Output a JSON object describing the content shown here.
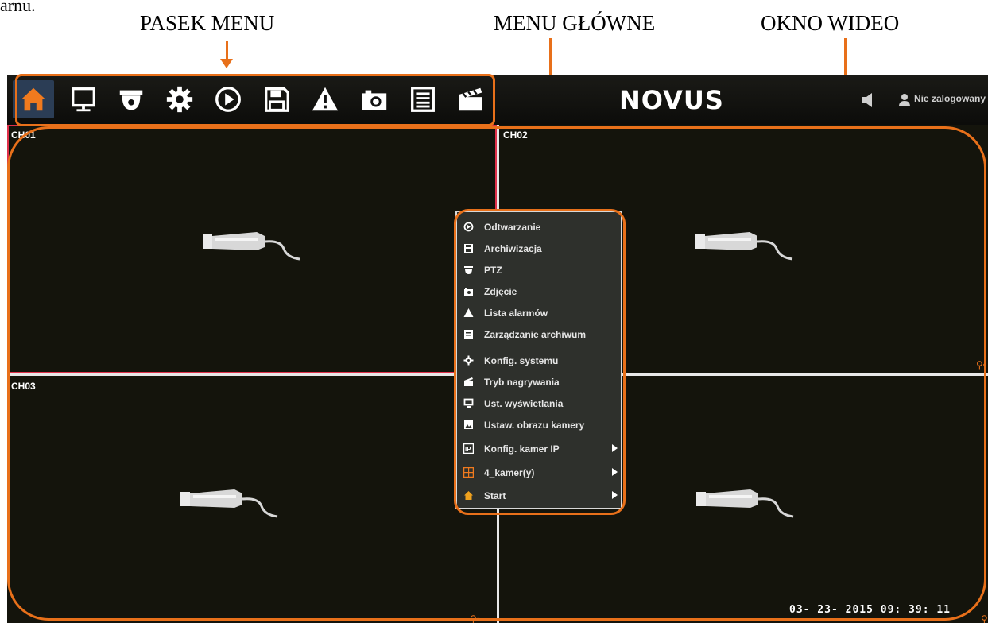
{
  "doc_fragment": "arnu.",
  "callouts": {
    "menubar": "PASEK MENU",
    "mainmenu": "MENU GŁÓWNE",
    "video": "OKNO WIDEO"
  },
  "accent_color": "#e8701a",
  "toolbar": {
    "icons": [
      "home-icon",
      "monitor-icon",
      "ptz-camera-icon",
      "gear-icon",
      "playback-icon",
      "floppy-disk-icon",
      "alarm-warning-icon",
      "snapshot-camera-icon",
      "list-icon",
      "clapperboard-icon"
    ]
  },
  "header": {
    "logo": "NOVUS",
    "user_status": "Nie zalogowany"
  },
  "tiles": [
    {
      "channel": "CH01",
      "selected": true
    },
    {
      "channel": "CH02",
      "selected": false
    },
    {
      "channel": "CH03",
      "selected": false
    },
    {
      "channel": "",
      "selected": false
    }
  ],
  "datetime": "03- 23- 2015 09: 39: 11",
  "main_menu": {
    "items": [
      {
        "label": "Odtwarzanie",
        "icon": "playback-icon",
        "submenu": false
      },
      {
        "label": "Archiwizacja",
        "icon": "floppy-disk-icon",
        "submenu": false
      },
      {
        "label": "PTZ",
        "icon": "ptz-camera-icon",
        "submenu": false
      },
      {
        "label": "Zdjęcie",
        "icon": "snapshot-camera-icon",
        "submenu": false
      },
      {
        "label": "Lista alarmów",
        "icon": "alarm-warning-icon",
        "submenu": false
      },
      {
        "label": "Zarządzanie archiwum",
        "icon": "list-icon",
        "submenu": false
      },
      {
        "label": "Konfig. systemu",
        "icon": "gear-icon",
        "submenu": false
      },
      {
        "label": "Tryb nagrywania",
        "icon": "clapperboard-icon",
        "submenu": false
      },
      {
        "label": "Ust. wyświetlania",
        "icon": "monitor-icon",
        "submenu": false
      },
      {
        "label": "Ustaw. obrazu kamery",
        "icon": "image-icon",
        "submenu": false
      },
      {
        "label": "Konfig. kamer IP",
        "icon": "ip-camera-icon",
        "submenu": true
      },
      {
        "label": "4_kamer(y)",
        "icon": "grid-icon",
        "submenu": true
      },
      {
        "label": "Start",
        "icon": "home-icon",
        "submenu": true
      }
    ]
  }
}
